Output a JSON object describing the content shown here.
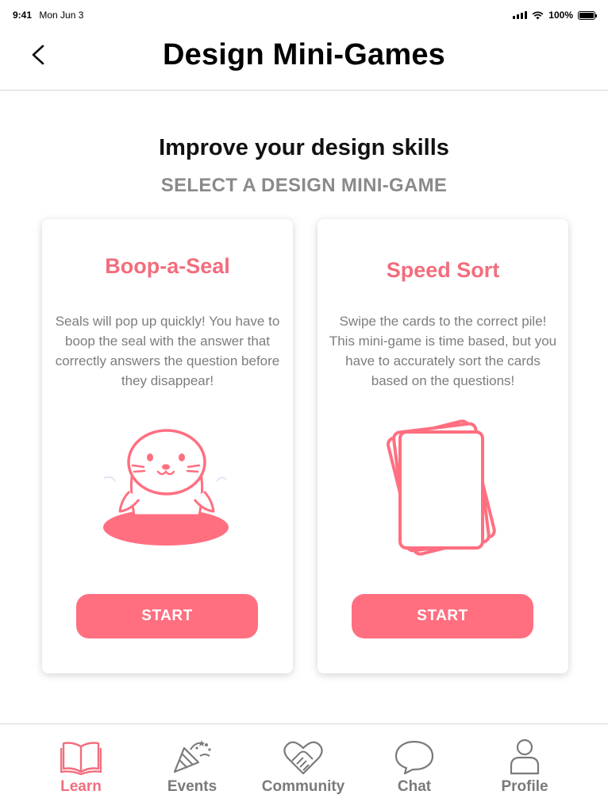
{
  "status_bar": {
    "time": "9:41",
    "date": "Mon Jun 3",
    "battery": "100%"
  },
  "header": {
    "title": "Design Mini-Games"
  },
  "intro": {
    "headline": "Improve your design skills",
    "subheadline": "SELECT A DESIGN MINI-GAME"
  },
  "games": [
    {
      "title": "Boop-a-Seal",
      "description": "Seals will pop up quickly! You have to boop the seal with the answer that correctly answers the question before they disappear!",
      "button_label": "START",
      "icon": "seal-icon"
    },
    {
      "title": "Speed Sort",
      "description": "Swipe the cards to the correct pile! This mini-game is time based, but you have to accurately sort the cards based on the questions!",
      "button_label": "START",
      "icon": "cards-icon"
    }
  ],
  "tabs": [
    {
      "label": "Learn",
      "icon": "book-icon",
      "active": true
    },
    {
      "label": "Events",
      "icon": "party-popper-icon",
      "active": false
    },
    {
      "label": "Community",
      "icon": "handshake-heart-icon",
      "active": false
    },
    {
      "label": "Chat",
      "icon": "chat-bubble-icon",
      "active": false
    },
    {
      "label": "Profile",
      "icon": "person-icon",
      "active": false
    }
  ],
  "colors": {
    "accent": "#ff6f80",
    "accent_text": "#f26d7d",
    "muted_text": "#7d7d7d",
    "subheading": "#8a8a8a"
  }
}
